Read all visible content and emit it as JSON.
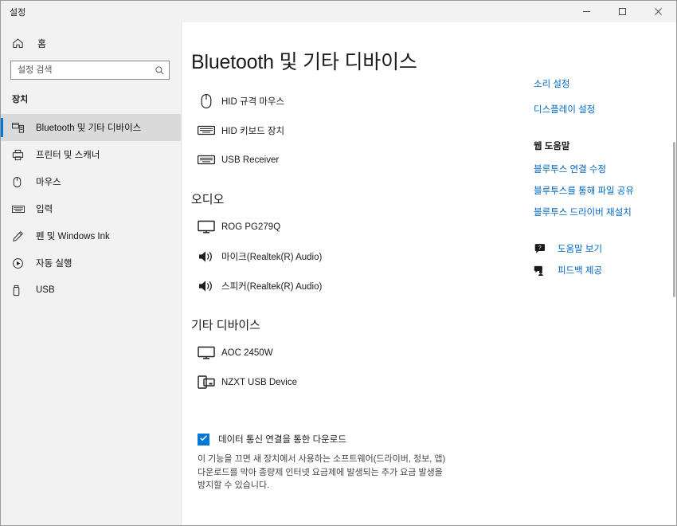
{
  "window": {
    "title": "설정",
    "controls": {
      "minimize": "minimize-icon",
      "maximize": "maximize-icon",
      "close": "close-icon"
    }
  },
  "sidebar": {
    "home_label": "홈",
    "home_icon": "home-icon",
    "search": {
      "placeholder": "설정 검색",
      "value": "",
      "icon": "search-icon"
    },
    "group_title": "장치",
    "items": [
      {
        "label": "Bluetooth 및 기타 디바이스",
        "icon": "bluetooth-devices-icon",
        "selected": true
      },
      {
        "label": "프린터 및 스캐너",
        "icon": "printer-icon",
        "selected": false
      },
      {
        "label": "마우스",
        "icon": "mouse-icon",
        "selected": false
      },
      {
        "label": "입력",
        "icon": "keyboard-icon",
        "selected": false
      },
      {
        "label": "펜 및 Windows Ink",
        "icon": "pen-icon",
        "selected": false
      },
      {
        "label": "자동 실행",
        "icon": "autoplay-icon",
        "selected": false
      },
      {
        "label": "USB",
        "icon": "usb-icon",
        "selected": false
      }
    ]
  },
  "main": {
    "page_title": "Bluetooth 및 기타 디바이스",
    "sections": [
      {
        "title": "",
        "devices": [
          {
            "name": "HID 규격 마우스",
            "icon": "mouse-icon"
          },
          {
            "name": "HID 키보드 장치",
            "icon": "keyboard-icon"
          },
          {
            "name": "USB Receiver",
            "icon": "keyboard-icon"
          }
        ]
      },
      {
        "title": "오디오",
        "devices": [
          {
            "name": "ROG PG279Q",
            "icon": "monitor-icon"
          },
          {
            "name": "마이크(Realtek(R) Audio)",
            "icon": "speaker-icon"
          },
          {
            "name": "스피커(Realtek(R) Audio)",
            "icon": "speaker-icon"
          }
        ]
      },
      {
        "title": "기타 디바이스",
        "devices": [
          {
            "name": "AOC 2450W",
            "icon": "monitor-icon"
          },
          {
            "name": "NZXT USB Device",
            "icon": "multi-device-icon"
          }
        ]
      }
    ],
    "metered": {
      "label": "데이터 통신 연결을 통한 다운로드",
      "checked": true,
      "description": "이 기능을 끄면 새 장치에서 사용하는 소프트웨어(드라이버, 정보, 앱) 다운로드를 막아 종량제 인터넷 요금제에 발생되는 추가 요금 발생을 방지할 수 있습니다."
    }
  },
  "right_rail": {
    "top_links": [
      {
        "label": "소리 설정"
      },
      {
        "label": "디스플레이 설정"
      }
    ],
    "web_help_heading": "웹 도움말",
    "web_help_links": [
      {
        "label": "블루투스 연결 수정"
      },
      {
        "label": "블루투스를 통해 파일 공유"
      },
      {
        "label": "블루투스 드라이버 재설치"
      }
    ],
    "icon_links": [
      {
        "label": "도움말 보기",
        "icon": "help-bubble-icon"
      },
      {
        "label": "피드백 제공",
        "icon": "feedback-icon"
      }
    ]
  },
  "colors": {
    "accent": "#0078d7",
    "link": "#0067c0",
    "sidebar_bg": "#f2f2f2",
    "selected_bg": "#dadada"
  }
}
